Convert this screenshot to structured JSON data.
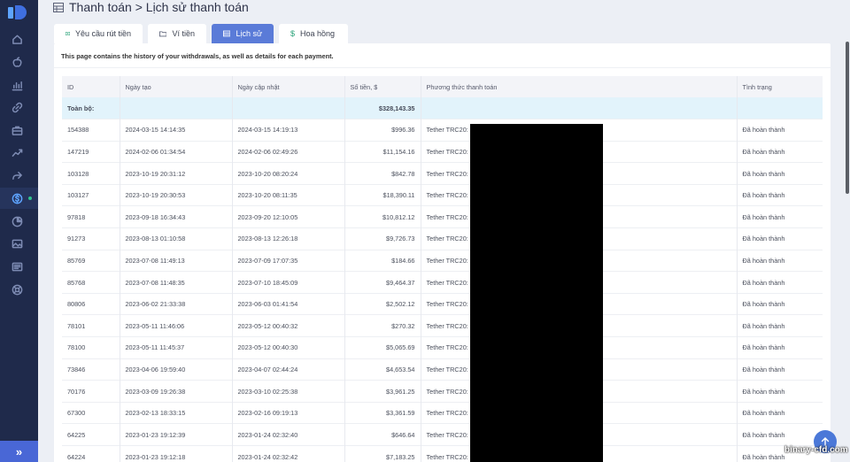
{
  "header": {
    "title": "Thanh toán > Lịch sử thanh toán"
  },
  "tabs": [
    {
      "label": "Yêu cầu rút tiền",
      "icon": "withdraw-icon"
    },
    {
      "label": "Ví tiền",
      "icon": "wallet-icon"
    },
    {
      "label": "Lịch sử",
      "icon": "table-icon",
      "active": true
    },
    {
      "label": "Hoa hồng",
      "icon": "dollar-icon",
      "icon_glyph": "$"
    }
  ],
  "intro": "This page contains the history of your withdrawals, as well as details for each payment.",
  "table": {
    "headers": [
      "ID",
      "Ngày tạo",
      "Ngày cập nhật",
      "Số tiền, $",
      "Phương thức thanh toán",
      "Tình trạng"
    ],
    "total": {
      "label": "Toàn bộ:",
      "amount": "$328,143.35"
    },
    "rows": [
      [
        "154388",
        "2024-03-15 14:14:35",
        "2024-03-15 14:19:13",
        "$996.36",
        "Tether TRC20:",
        "Đã hoàn thành"
      ],
      [
        "147219",
        "2024-02-06 01:34:54",
        "2024-02-06 02:49:26",
        "$11,154.16",
        "Tether TRC20:",
        "Đã hoàn thành"
      ],
      [
        "103128",
        "2023-10-19 20:31:12",
        "2023-10-20 08:20:24",
        "$842.78",
        "Tether TRC20:",
        "Đã hoàn thành"
      ],
      [
        "103127",
        "2023-10-19 20:30:53",
        "2023-10-20 08:11:35",
        "$18,390.11",
        "Tether TRC20:",
        "Đã hoàn thành"
      ],
      [
        "97818",
        "2023-09-18 16:34:43",
        "2023-09-20 12:10:05",
        "$10,812.12",
        "Tether TRC20:",
        "Đã hoàn thành"
      ],
      [
        "91273",
        "2023-08-13 01:10:58",
        "2023-08-13 12:26:18",
        "$9,726.73",
        "Tether TRC20:",
        "Đã hoàn thành"
      ],
      [
        "85769",
        "2023-07-08 11:49:13",
        "2023-07-09 17:07:35",
        "$184.66",
        "Tether TRC20:",
        "Đã hoàn thành"
      ],
      [
        "85768",
        "2023-07-08 11:48:35",
        "2023-07-10 18:45:09",
        "$9,464.37",
        "Tether TRC20:",
        "Đã hoàn thành"
      ],
      [
        "80806",
        "2023-06-02 21:33:38",
        "2023-06-03 01:41:54",
        "$2,502.12",
        "Tether TRC20:",
        "Đã hoàn thành"
      ],
      [
        "78101",
        "2023-05-11 11:46:06",
        "2023-05-12 00:40:32",
        "$270.32",
        "Tether TRC20:",
        "Đã hoàn thành"
      ],
      [
        "78100",
        "2023-05-11 11:45:37",
        "2023-05-12 00:40:30",
        "$5,065.69",
        "Tether TRC20:",
        "Đã hoàn thành"
      ],
      [
        "73846",
        "2023-04-06 19:59:40",
        "2023-04-07 02:44:24",
        "$4,653.54",
        "Tether TRC20:",
        "Đã hoàn thành"
      ],
      [
        "70176",
        "2023-03-09 19:26:38",
        "2023-03-10 02:25:38",
        "$3,961.25",
        "Tether TRC20:",
        "Đã hoàn thành"
      ],
      [
        "67300",
        "2023-02-13 18:33:15",
        "2023-02-16 09:19:13",
        "$3,361.59",
        "Tether TRC20:",
        "Đã hoàn thành"
      ],
      [
        "64225",
        "2023-01-23 19:12:39",
        "2023-01-24 02:32:40",
        "$646.64",
        "Tether TRC20:",
        "Đã hoàn thành"
      ],
      [
        "64224",
        "2023-01-23 19:12:18",
        "2023-01-24 02:32:42",
        "$7,183.25",
        "Tether TRC20:",
        "Đã hoàn thành"
      ]
    ]
  },
  "sidebar": {
    "icons": [
      "home-icon",
      "apple-icon",
      "chart-icon",
      "link-icon",
      "briefcase-icon",
      "trend-icon",
      "share-icon",
      "dollar-icon",
      "pie-icon",
      "image-icon",
      "list-icon",
      "support-icon"
    ],
    "collapse_label": "»"
  },
  "watermark": "binary-cfd.com",
  "colors": {
    "sidebar": "#1f2a4b",
    "accent": "#5a7bd8",
    "total_row": "#e2f3fb"
  }
}
